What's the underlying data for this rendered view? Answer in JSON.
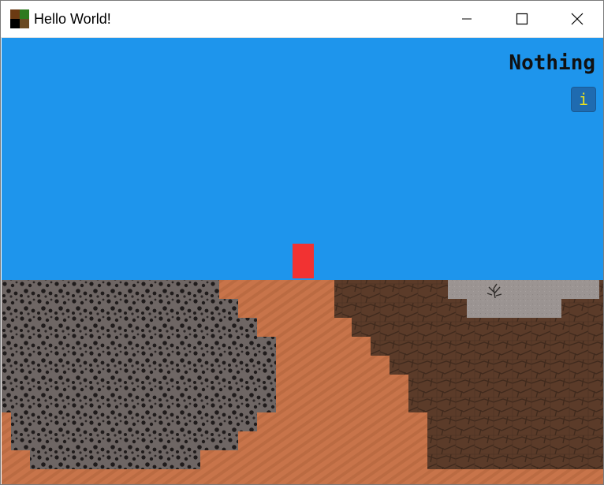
{
  "window": {
    "title": "Hello World!",
    "controls": {
      "minimize": "minimize",
      "maximize": "maximize",
      "close": "close"
    }
  },
  "game": {
    "held_item_label": "Nothing",
    "info_button_label": "i",
    "colors": {
      "sky": "#1e95ec",
      "dirt": "#c8744a",
      "dirt_stripe": "#b86a40",
      "gravel": "#6c6462",
      "gravel_dot": "#1e1a1a",
      "wood": "#5a3a28",
      "wood_line": "#3f281c",
      "stone": "#9a9391",
      "player": "#f03030",
      "info_bg": "#1f6bb0",
      "info_fg": "#e8e020"
    }
  }
}
